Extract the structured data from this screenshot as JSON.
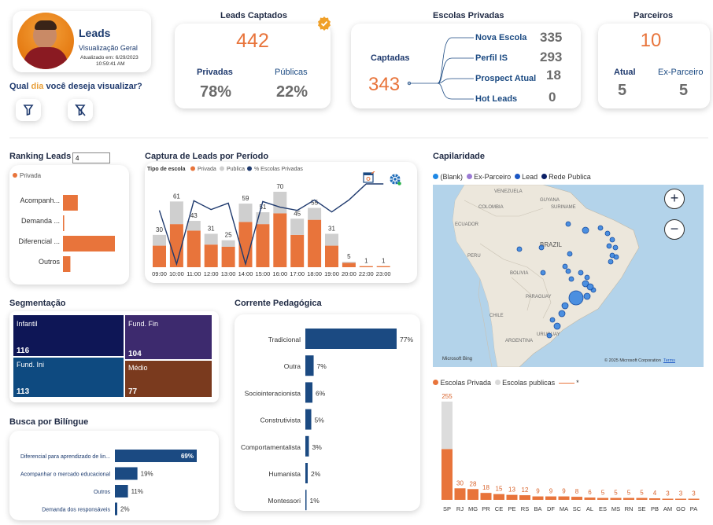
{
  "profile": {
    "title": "Leads",
    "subtitle": "Visualização Geral",
    "updated_label": "Atualizado em: 6/29/2023",
    "updated_time": "10:59:41 AM"
  },
  "question": {
    "before": "Qual ",
    "highlight": "dia",
    "after": " você deseja visualizar?"
  },
  "leads_captados": {
    "title": "Leads Captados",
    "total": "442",
    "privadas_label": "Privadas",
    "privadas_value": "78%",
    "publicas_label": "Públicas",
    "publicas_value": "22%"
  },
  "escolas_privadas": {
    "title": "Escolas Privadas",
    "captadas_label": "Captadas",
    "captadas_value": "343",
    "items": [
      {
        "label": "Nova Escola",
        "value": "335"
      },
      {
        "label": "Perfil IS",
        "value": "293"
      },
      {
        "label": "Prospect Atual",
        "value": "18"
      },
      {
        "label": "Hot Leads",
        "value": "0"
      }
    ]
  },
  "parceiros": {
    "title": "Parceiros",
    "total": "10",
    "atual_label": "Atual",
    "atual_value": "5",
    "ex_label": "Ex-Parceiro",
    "ex_value": "5"
  },
  "ranking": {
    "title": "Ranking Leads",
    "input_value": "4",
    "legend": "Privada",
    "chart_data": {
      "type": "bar",
      "categories": [
        "Acompanh...",
        "Demanda ...",
        "Diferencial ...",
        "Outros"
      ],
      "values": [
        12,
        1,
        42,
        6
      ]
    }
  },
  "captura": {
    "title": "Captura de Leads por Período",
    "legend_title": "Tipo de escola",
    "legend_privada": "Privada",
    "legend_publica": "Publica",
    "legend_pct": "% Escolas Privadas",
    "chart_data": {
      "type": "bar",
      "categories": [
        "09:00",
        "10:00",
        "11:00",
        "12:00",
        "13:00",
        "14:00",
        "15:00",
        "16:00",
        "17:00",
        "18:00",
        "19:00",
        "20:00",
        "22:00",
        "23:00"
      ],
      "totals": [
        30,
        61,
        43,
        31,
        25,
        59,
        51,
        70,
        45,
        55,
        31,
        5,
        1,
        1
      ],
      "series": [
        {
          "name": "Privada",
          "values": [
            20,
            40,
            34,
            21,
            19,
            42,
            40,
            50,
            30,
            44,
            20,
            4,
            1,
            1
          ]
        },
        {
          "name": "Publica",
          "values": [
            10,
            21,
            9,
            10,
            6,
            17,
            11,
            20,
            15,
            11,
            11,
            1,
            0,
            0
          ]
        },
        {
          "name": "% Escolas Privadas",
          "values": [
            67,
            0,
            79,
            68,
            76,
            0,
            78,
            71,
            67,
            80,
            65,
            80,
            100,
            100
          ]
        }
      ]
    }
  },
  "capilaridade": {
    "title": "Capilaridade",
    "legend": [
      {
        "label": "(Blank)",
        "color": "#1e88e5"
      },
      {
        "label": "Ex-Parceiro",
        "color": "#9b7bd4"
      },
      {
        "label": "Lead",
        "color": "#1b57c4"
      },
      {
        "label": "Rede Publica",
        "color": "#0b1f66"
      }
    ],
    "map_labels": [
      "VENEZUELA",
      "COLOMBIA",
      "GUYANA",
      "SURINAME",
      "ECUADOR",
      "PERU",
      "BRAZIL",
      "BOLIVIA",
      "PARAGUAY",
      "CHILE",
      "URUGUAY",
      "ARGENTINA"
    ],
    "bing": "Microsoft Bing",
    "copyright": "© 2025 Microsoft Corporation",
    "terms": "Terms",
    "zoom_in": "+",
    "zoom_out": "−"
  },
  "estados": {
    "legend_privada": "Escolas Privada",
    "legend_publica": "Escolas publicas",
    "legend_star": "*",
    "chart_data": {
      "type": "bar",
      "categories": [
        "SP",
        "RJ",
        "MG",
        "PR",
        "CE",
        "PE",
        "RS",
        "BA",
        "DF",
        "MA",
        "SC",
        "AL",
        "ES",
        "MS",
        "RN",
        "SE",
        "PB",
        "AM",
        "GO",
        "PA"
      ],
      "series": [
        {
          "name": "Escolas Privada",
          "values": [
            132,
            30,
            28,
            18,
            15,
            13,
            12,
            9,
            9,
            9,
            8,
            6,
            5,
            5,
            5,
            5,
            4,
            3,
            3,
            3
          ]
        },
        {
          "name": "Escolas publicas",
          "values": [
            123,
            0,
            0,
            0,
            0,
            0,
            0,
            0,
            0,
            0,
            0,
            0,
            0,
            0,
            0,
            0,
            0,
            0,
            0,
            0
          ]
        }
      ],
      "labels": [
        "255",
        "30",
        "28",
        "18",
        "15",
        "13",
        "12",
        "9",
        "9",
        "9",
        "8",
        "6",
        "5",
        "5",
        "5",
        "5",
        "4",
        "3",
        "3",
        "3"
      ]
    }
  },
  "segmentacao": {
    "title": "Segmentação",
    "cells": [
      {
        "label": "Infantil",
        "value": "116",
        "color": "#0e1656"
      },
      {
        "label": "Fund. Fin",
        "value": "104",
        "color": "#3d2a6e"
      },
      {
        "label": "Fund. Ini",
        "value": "113",
        "color": "#0e4a80"
      },
      {
        "label": "Médio",
        "value": "77",
        "color": "#7a3a1e"
      }
    ]
  },
  "corrente": {
    "title": "Corrente Pedagógica",
    "chart_data": {
      "type": "bar",
      "categories": [
        "Tradicional",
        "Outra",
        "Sociointeracionista",
        "Construtivista",
        "Comportamentalista",
        "Humanista",
        "Montessori"
      ],
      "values": [
        77,
        7,
        6,
        5,
        3,
        2,
        1
      ],
      "labels": [
        "77%",
        "7%",
        "6%",
        "5%",
        "3%",
        "2%",
        "1%"
      ]
    }
  },
  "bilingue": {
    "title": "Busca por Bilíngue",
    "chart_data": {
      "type": "bar",
      "categories": [
        "Diferencial para aprendizado de lin...",
        "Acompanhar o mercado educacional",
        "Outros",
        "Demanda dos responsáveis"
      ],
      "values": [
        69,
        19,
        11,
        2
      ],
      "labels": [
        "69%",
        "19%",
        "11%",
        "2%"
      ]
    }
  },
  "colors": {
    "orange": "#e8743b",
    "light_gray": "#cfcfcf",
    "navy": "#1b4a82",
    "dark_navy": "#1f3a6e"
  }
}
